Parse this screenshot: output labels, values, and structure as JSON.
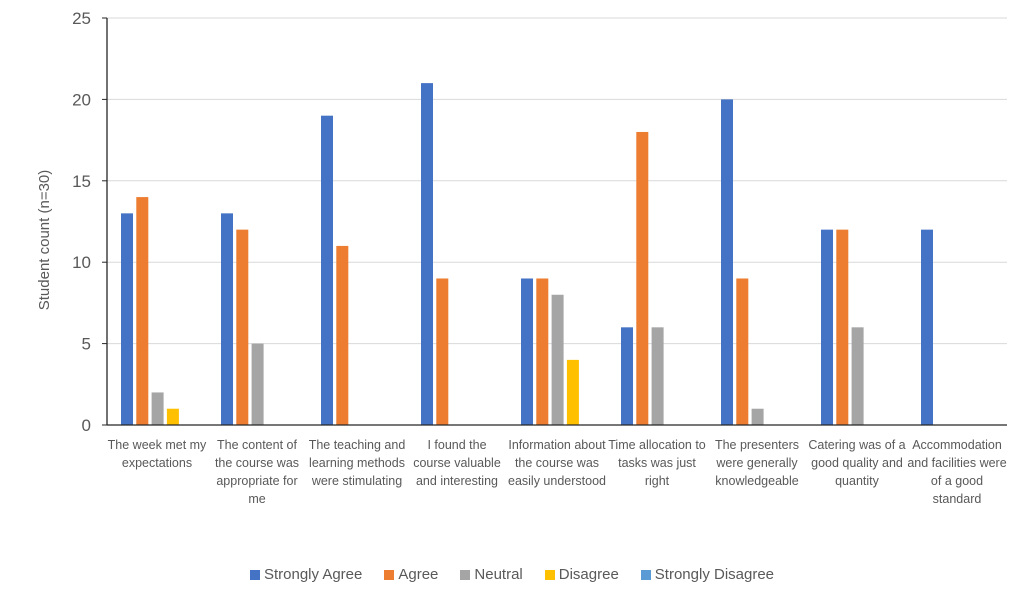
{
  "chart_data": {
    "type": "bar",
    "title": "",
    "xlabel": "",
    "ylabel": "Student count (n=30)",
    "ylim": [
      0,
      25
    ],
    "yticks": [
      0,
      5,
      10,
      15,
      20,
      25
    ],
    "grid": true,
    "legend_position": "bottom",
    "categories": [
      "The week met my expectations",
      "The content of the course was appropriate for me",
      "The teaching and learning methods were stimulating",
      "I found the course valuable and interesting",
      "Information about the course was easily understood",
      "Time allocation to tasks was just right",
      "The presenters were generally knowledgeable",
      "Catering was of a good quality and quantity",
      "Accommodation and facilities were of a good standard"
    ],
    "series": [
      {
        "name": "Strongly Agree",
        "color": "#4472C4",
        "values": [
          13,
          13,
          19,
          21,
          9,
          6,
          20,
          12,
          12
        ]
      },
      {
        "name": "Agree",
        "color": "#ED7D31",
        "values": [
          14,
          12,
          11,
          9,
          9,
          18,
          9,
          12,
          0
        ]
      },
      {
        "name": "Neutral",
        "color": "#A5A5A5",
        "values": [
          2,
          5,
          0,
          0,
          8,
          6,
          1,
          6,
          0
        ]
      },
      {
        "name": "Disagree",
        "color": "#FFC000",
        "values": [
          1,
          0,
          0,
          0,
          4,
          0,
          0,
          0,
          0
        ]
      },
      {
        "name": "Strongly Disagree",
        "color": "#5B9BD5",
        "values": [
          0,
          0,
          0,
          0,
          0,
          0,
          0,
          0,
          0
        ]
      }
    ]
  }
}
